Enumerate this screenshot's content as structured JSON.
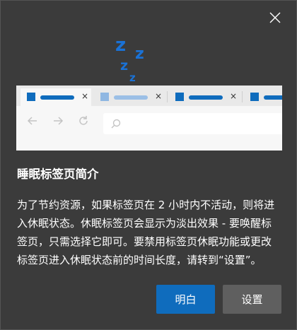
{
  "dialog": {
    "title": "睡眠标签页简介",
    "body": "为了节约资源，如果标签页在 2 小时内不活动，则将进入休眠状态。休眠标签页会显示为淡出效果 - 要唤醒标签页，只需选择它即可。要禁用标签页休眠功能或更改标签页进入休眠状态前的时间长度，请转到“设置”。",
    "ok_label": "明白",
    "settings_label": "设置",
    "close_icon": "close-icon"
  },
  "illustration": {
    "sleep_icon": "zzz-sleep-icon",
    "sleep_letters": [
      "z",
      "z",
      "z",
      "z"
    ],
    "tab_close_glyph": "×",
    "nav_icons": [
      "back-arrow-icon",
      "forward-arrow-icon",
      "refresh-icon",
      "search-icon"
    ]
  },
  "colors": {
    "background": "#3b3b3b",
    "accent": "#0f6cbd",
    "secondary_button": "#5f5f5f",
    "text": "#ffffff"
  }
}
